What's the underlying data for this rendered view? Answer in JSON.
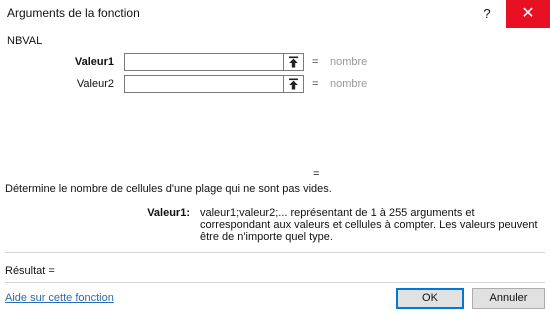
{
  "window": {
    "title": "Arguments de la fonction",
    "help_label": "?",
    "close_label": "✕",
    "close_color": "#e81123"
  },
  "function_name": "NBVAL",
  "arguments": [
    {
      "label": "Valeur1",
      "value": "",
      "equals": "=",
      "result": "nombre"
    },
    {
      "label": "Valeur2",
      "value": "",
      "equals": "=",
      "result": "nombre"
    }
  ],
  "function_result_equals": "=",
  "description": "Détermine le nombre de cellules d'une plage qui ne sont pas vides.",
  "argument_detail": {
    "label": "Valeur1:",
    "text": "valeur1;valeur2;... représentant de 1 à 255 arguments et correspondant aux valeurs et cellules à compter. Les valeurs peuvent être de n'importe quel type."
  },
  "result_label": "Résultat =",
  "help_link": "Aide sur cette fonction",
  "buttons": {
    "ok": "OK",
    "cancel": "Annuler"
  },
  "icons": {
    "collapse_dialog": "collapse-dialog-icon"
  },
  "colors": {
    "accent": "#0078d7",
    "link": "#2b6cb0",
    "muted_value": "#9a9a9a"
  }
}
